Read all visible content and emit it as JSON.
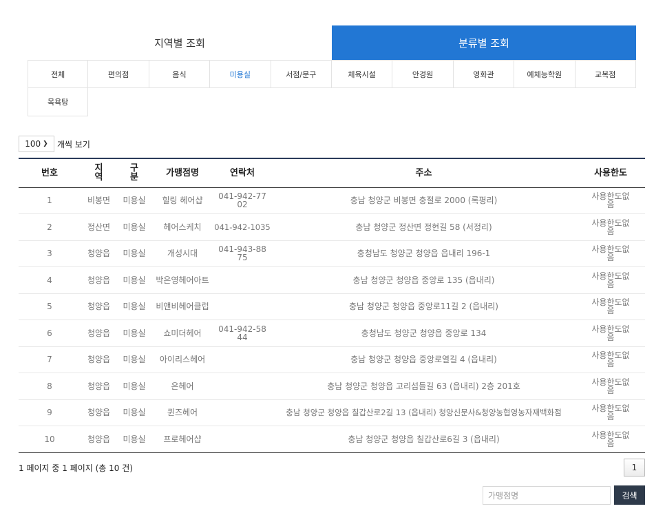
{
  "view_tabs": [
    {
      "label": "지역별 조회"
    },
    {
      "label": "분류별 조회"
    }
  ],
  "categories_row1": [
    {
      "label": "전체"
    },
    {
      "label": "편의점"
    },
    {
      "label": "음식"
    },
    {
      "label": "미용실"
    },
    {
      "label": "서점/문구"
    },
    {
      "label": "체육시설"
    },
    {
      "label": "안경원"
    },
    {
      "label": "영화관"
    },
    {
      "label": "예체능학원"
    },
    {
      "label": "교복점"
    }
  ],
  "categories_row2": [
    {
      "label": "목욕탕"
    }
  ],
  "page_size": {
    "value": "100",
    "suffix": "개씩 보기"
  },
  "table": {
    "headers": {
      "no": "번호",
      "region": "지역",
      "kind": "구분",
      "name": "가맹점명",
      "phone": "연락처",
      "address": "주소",
      "limit": "사용한도"
    },
    "rows": [
      {
        "no": "1",
        "region": "비봉면",
        "kind": "미용실",
        "name": "힐링 헤어샵",
        "phone": "041-942-7702",
        "address": "충남 청양군 비봉면 충절로 2000 (록평리)",
        "limit": "사용한도없음"
      },
      {
        "no": "2",
        "region": "정산면",
        "kind": "미용실",
        "name": "헤어스케치",
        "phone": "041-942-1035",
        "address": "충남 청양군 정산면 정현길 58 (서정리)",
        "limit": "사용한도없음"
      },
      {
        "no": "3",
        "region": "청양읍",
        "kind": "미용실",
        "name": "개성시대",
        "phone": "041-943-8875",
        "address": "충청남도 청양군 청양읍 읍내리 196-1",
        "limit": "사용한도없음"
      },
      {
        "no": "4",
        "region": "청양읍",
        "kind": "미용실",
        "name": "박은영헤어아트",
        "phone": "",
        "address": "충남 청양군 청양읍 중앙로 135 (읍내리)",
        "limit": "사용한도없음"
      },
      {
        "no": "5",
        "region": "청양읍",
        "kind": "미용실",
        "name": "비앤비헤어클럽",
        "phone": "",
        "address": "충남 청양군 청양읍 중앙로11길 2 (읍내리)",
        "limit": "사용한도없음"
      },
      {
        "no": "6",
        "region": "청양읍",
        "kind": "미용실",
        "name": "쇼미더헤어",
        "phone": "041-942-5844",
        "address": "충청남도 청양군 청양읍 중앙로 134",
        "limit": "사용한도없음"
      },
      {
        "no": "7",
        "region": "청양읍",
        "kind": "미용실",
        "name": "아이리스헤어",
        "phone": "",
        "address": "충남 청양군 청양읍 중앙로열길 4 (읍내리)",
        "limit": "사용한도없음"
      },
      {
        "no": "8",
        "region": "청양읍",
        "kind": "미용실",
        "name": "은헤어",
        "phone": "",
        "address": "충남 청양군 청양읍 고리섬들길 63 (읍내리) 2층 201호",
        "limit": "사용한도없음"
      },
      {
        "no": "9",
        "region": "청양읍",
        "kind": "미용실",
        "name": "퀸즈헤어",
        "phone": "",
        "address": "충남 청양군 청양읍 칠갑산로2길 13 (읍내리) 청양신문사&청양농협영농자재백화점",
        "limit": "사용한도없음"
      },
      {
        "no": "10",
        "region": "청양읍",
        "kind": "미용실",
        "name": "프로헤어샵",
        "phone": "",
        "address": "충남 청양군 청양읍 칠갑산로6길 3 (읍내리)",
        "limit": "사용한도없음"
      }
    ]
  },
  "pagination": {
    "info": "1 페이지 중 1 페이지 (총 10 건)",
    "page": "1"
  },
  "search": {
    "placeholder": "가맹점명",
    "button": "검색"
  },
  "colors": {
    "accent": "#2277d4",
    "link": "#1d3fd6",
    "search_button": "#2e3a4a"
  }
}
